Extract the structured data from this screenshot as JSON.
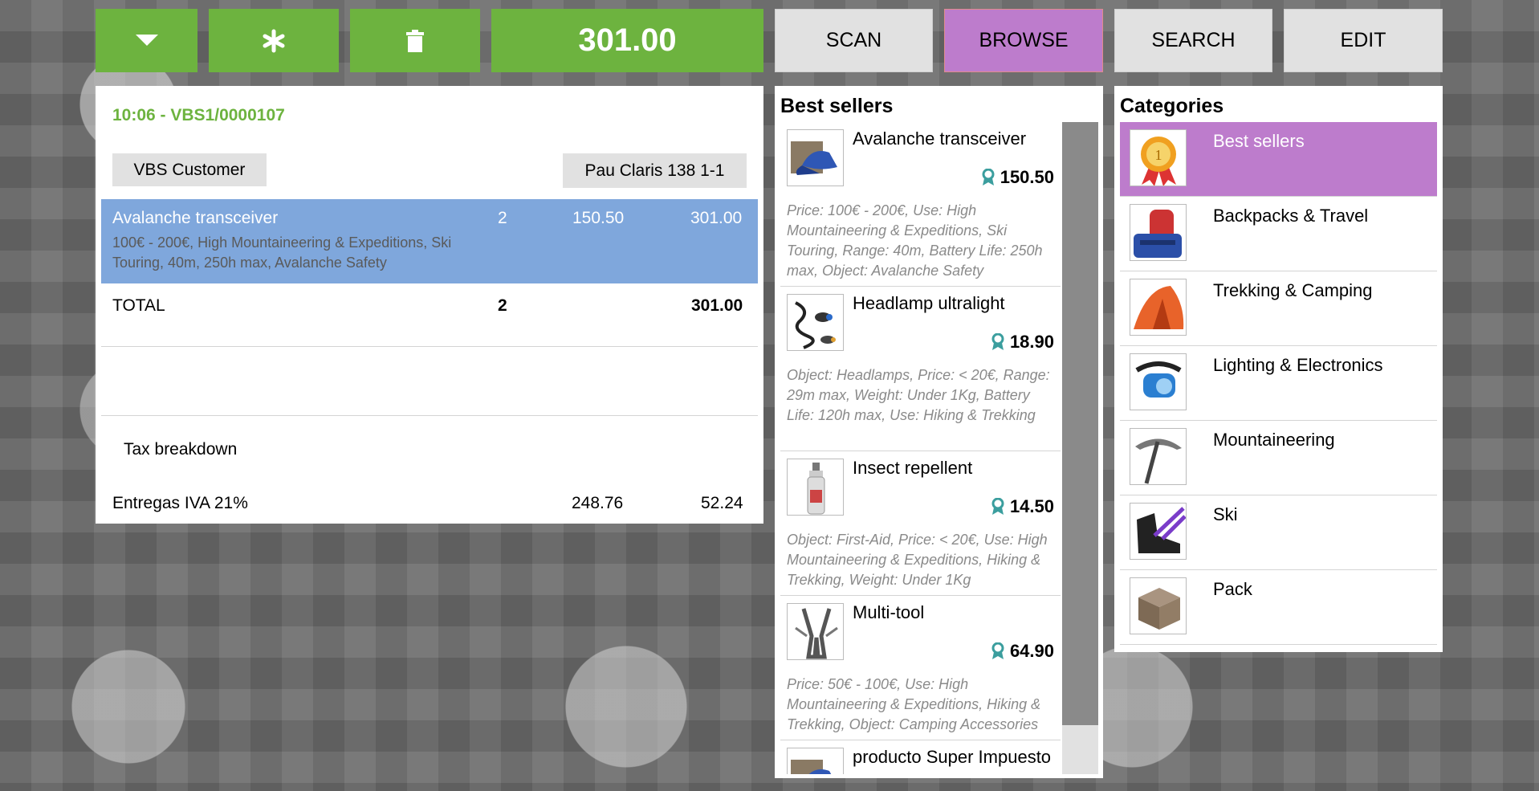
{
  "toolbar": {
    "total": "301.00",
    "tabs": [
      "SCAN",
      "BROWSE",
      "SEARCH",
      "EDIT"
    ],
    "active_tab": "BROWSE"
  },
  "receipt": {
    "order_id": "10:06 - VBS1/0000107",
    "customer": "VBS Customer",
    "address": "Pau Claris 138 1-1",
    "line": {
      "name": "Avalanche transceiver",
      "qty": "2",
      "price": "150.50",
      "amount": "301.00",
      "description": "100€ - 200€, High Mountaineering & Expeditions, Ski Touring, 40m, 250h max, Avalanche Safety"
    },
    "total_label": "TOTAL",
    "total_qty": "2",
    "total_amount": "301.00",
    "tax_title": "Tax breakdown",
    "tax_row": {
      "name": "Entregas IVA 21%",
      "base": "248.76",
      "tax": "52.24"
    }
  },
  "products": {
    "title": "Best sellers",
    "items": [
      {
        "name": "Avalanche transceiver",
        "price": "150.50",
        "desc": "Price: 100€ - 200€, Use: High Mountaineering & Expeditions, Ski Touring, Range: 40m, Battery Life: 250h max, Object: Avalanche Safety",
        "icon": "cap-icon"
      },
      {
        "name": "Headlamp ultralight",
        "price": "18.90",
        "desc": "Object: Headlamps, Price: < 20€, Range: 29m max, Weight: Under 1Kg, Battery Life: 120h max, Use: Hiking & Trekking",
        "icon": "headlamp-icon"
      },
      {
        "name": "Insect repellent",
        "price": "14.50",
        "desc": "Object: First-Aid, Price: < 20€, Use: High Mountaineering & Expeditions, Hiking & Trekking, Weight: Under 1Kg",
        "icon": "spray-bottle-icon"
      },
      {
        "name": "Multi-tool",
        "price": "64.90",
        "desc": "Price: 50€ - 100€, Use: High Mountaineering & Expeditions, Hiking & Trekking, Object: Camping Accessories",
        "icon": "multitool-icon"
      },
      {
        "name": "producto Super Impuesto",
        "price": "",
        "desc": "",
        "icon": "cap-icon"
      }
    ]
  },
  "categories": {
    "title": "Categories",
    "items": [
      {
        "label": "Best sellers",
        "icon": "medal-icon",
        "selected": true
      },
      {
        "label": "Backpacks & Travel",
        "icon": "backpack-icon",
        "selected": false
      },
      {
        "label": "Trekking & Camping",
        "icon": "tent-icon",
        "selected": false
      },
      {
        "label": "Lighting & Electronics",
        "icon": "headlamp-icon",
        "selected": false
      },
      {
        "label": "Mountaineering",
        "icon": "ice-axe-icon",
        "selected": false
      },
      {
        "label": "Ski",
        "icon": "ski-boot-icon",
        "selected": false
      },
      {
        "label": "Pack",
        "icon": "box-icon",
        "selected": false
      }
    ]
  },
  "colors": {
    "green": "#6db33f",
    "purple": "#bd7ccc",
    "selected_line": "#7fa7dc",
    "button_gray": "#e1e1e1"
  }
}
